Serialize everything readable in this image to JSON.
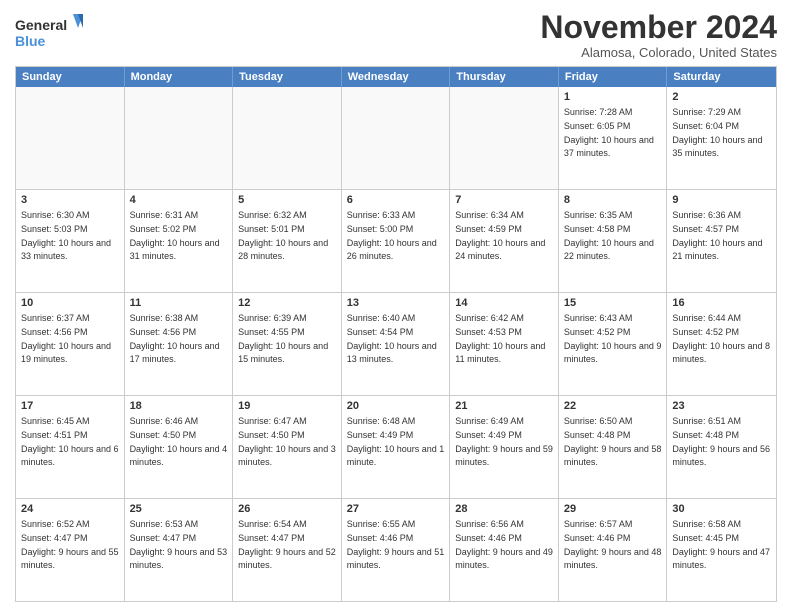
{
  "logo": {
    "general": "General",
    "blue": "Blue"
  },
  "header": {
    "month_title": "November 2024",
    "subtitle": "Alamosa, Colorado, United States"
  },
  "days_of_week": [
    "Sunday",
    "Monday",
    "Tuesday",
    "Wednesday",
    "Thursday",
    "Friday",
    "Saturday"
  ],
  "weeks": [
    [
      {
        "day": "",
        "empty": true
      },
      {
        "day": "",
        "empty": true
      },
      {
        "day": "",
        "empty": true
      },
      {
        "day": "",
        "empty": true
      },
      {
        "day": "",
        "empty": true
      },
      {
        "day": "1",
        "sunrise": "7:28 AM",
        "sunset": "6:05 PM",
        "daylight": "10 hours and 37 minutes."
      },
      {
        "day": "2",
        "sunrise": "7:29 AM",
        "sunset": "6:04 PM",
        "daylight": "10 hours and 35 minutes."
      }
    ],
    [
      {
        "day": "3",
        "sunrise": "6:30 AM",
        "sunset": "5:03 PM",
        "daylight": "10 hours and 33 minutes."
      },
      {
        "day": "4",
        "sunrise": "6:31 AM",
        "sunset": "5:02 PM",
        "daylight": "10 hours and 31 minutes."
      },
      {
        "day": "5",
        "sunrise": "6:32 AM",
        "sunset": "5:01 PM",
        "daylight": "10 hours and 28 minutes."
      },
      {
        "day": "6",
        "sunrise": "6:33 AM",
        "sunset": "5:00 PM",
        "daylight": "10 hours and 26 minutes."
      },
      {
        "day": "7",
        "sunrise": "6:34 AM",
        "sunset": "4:59 PM",
        "daylight": "10 hours and 24 minutes."
      },
      {
        "day": "8",
        "sunrise": "6:35 AM",
        "sunset": "4:58 PM",
        "daylight": "10 hours and 22 minutes."
      },
      {
        "day": "9",
        "sunrise": "6:36 AM",
        "sunset": "4:57 PM",
        "daylight": "10 hours and 21 minutes."
      }
    ],
    [
      {
        "day": "10",
        "sunrise": "6:37 AM",
        "sunset": "4:56 PM",
        "daylight": "10 hours and 19 minutes."
      },
      {
        "day": "11",
        "sunrise": "6:38 AM",
        "sunset": "4:56 PM",
        "daylight": "10 hours and 17 minutes."
      },
      {
        "day": "12",
        "sunrise": "6:39 AM",
        "sunset": "4:55 PM",
        "daylight": "10 hours and 15 minutes."
      },
      {
        "day": "13",
        "sunrise": "6:40 AM",
        "sunset": "4:54 PM",
        "daylight": "10 hours and 13 minutes."
      },
      {
        "day": "14",
        "sunrise": "6:42 AM",
        "sunset": "4:53 PM",
        "daylight": "10 hours and 11 minutes."
      },
      {
        "day": "15",
        "sunrise": "6:43 AM",
        "sunset": "4:52 PM",
        "daylight": "10 hours and 9 minutes."
      },
      {
        "day": "16",
        "sunrise": "6:44 AM",
        "sunset": "4:52 PM",
        "daylight": "10 hours and 8 minutes."
      }
    ],
    [
      {
        "day": "17",
        "sunrise": "6:45 AM",
        "sunset": "4:51 PM",
        "daylight": "10 hours and 6 minutes."
      },
      {
        "day": "18",
        "sunrise": "6:46 AM",
        "sunset": "4:50 PM",
        "daylight": "10 hours and 4 minutes."
      },
      {
        "day": "19",
        "sunrise": "6:47 AM",
        "sunset": "4:50 PM",
        "daylight": "10 hours and 3 minutes."
      },
      {
        "day": "20",
        "sunrise": "6:48 AM",
        "sunset": "4:49 PM",
        "daylight": "10 hours and 1 minute."
      },
      {
        "day": "21",
        "sunrise": "6:49 AM",
        "sunset": "4:49 PM",
        "daylight": "9 hours and 59 minutes."
      },
      {
        "day": "22",
        "sunrise": "6:50 AM",
        "sunset": "4:48 PM",
        "daylight": "9 hours and 58 minutes."
      },
      {
        "day": "23",
        "sunrise": "6:51 AM",
        "sunset": "4:48 PM",
        "daylight": "9 hours and 56 minutes."
      }
    ],
    [
      {
        "day": "24",
        "sunrise": "6:52 AM",
        "sunset": "4:47 PM",
        "daylight": "9 hours and 55 minutes."
      },
      {
        "day": "25",
        "sunrise": "6:53 AM",
        "sunset": "4:47 PM",
        "daylight": "9 hours and 53 minutes."
      },
      {
        "day": "26",
        "sunrise": "6:54 AM",
        "sunset": "4:47 PM",
        "daylight": "9 hours and 52 minutes."
      },
      {
        "day": "27",
        "sunrise": "6:55 AM",
        "sunset": "4:46 PM",
        "daylight": "9 hours and 51 minutes."
      },
      {
        "day": "28",
        "sunrise": "6:56 AM",
        "sunset": "4:46 PM",
        "daylight": "9 hours and 49 minutes."
      },
      {
        "day": "29",
        "sunrise": "6:57 AM",
        "sunset": "4:46 PM",
        "daylight": "9 hours and 48 minutes."
      },
      {
        "day": "30",
        "sunrise": "6:58 AM",
        "sunset": "4:45 PM",
        "daylight": "9 hours and 47 minutes."
      }
    ]
  ]
}
